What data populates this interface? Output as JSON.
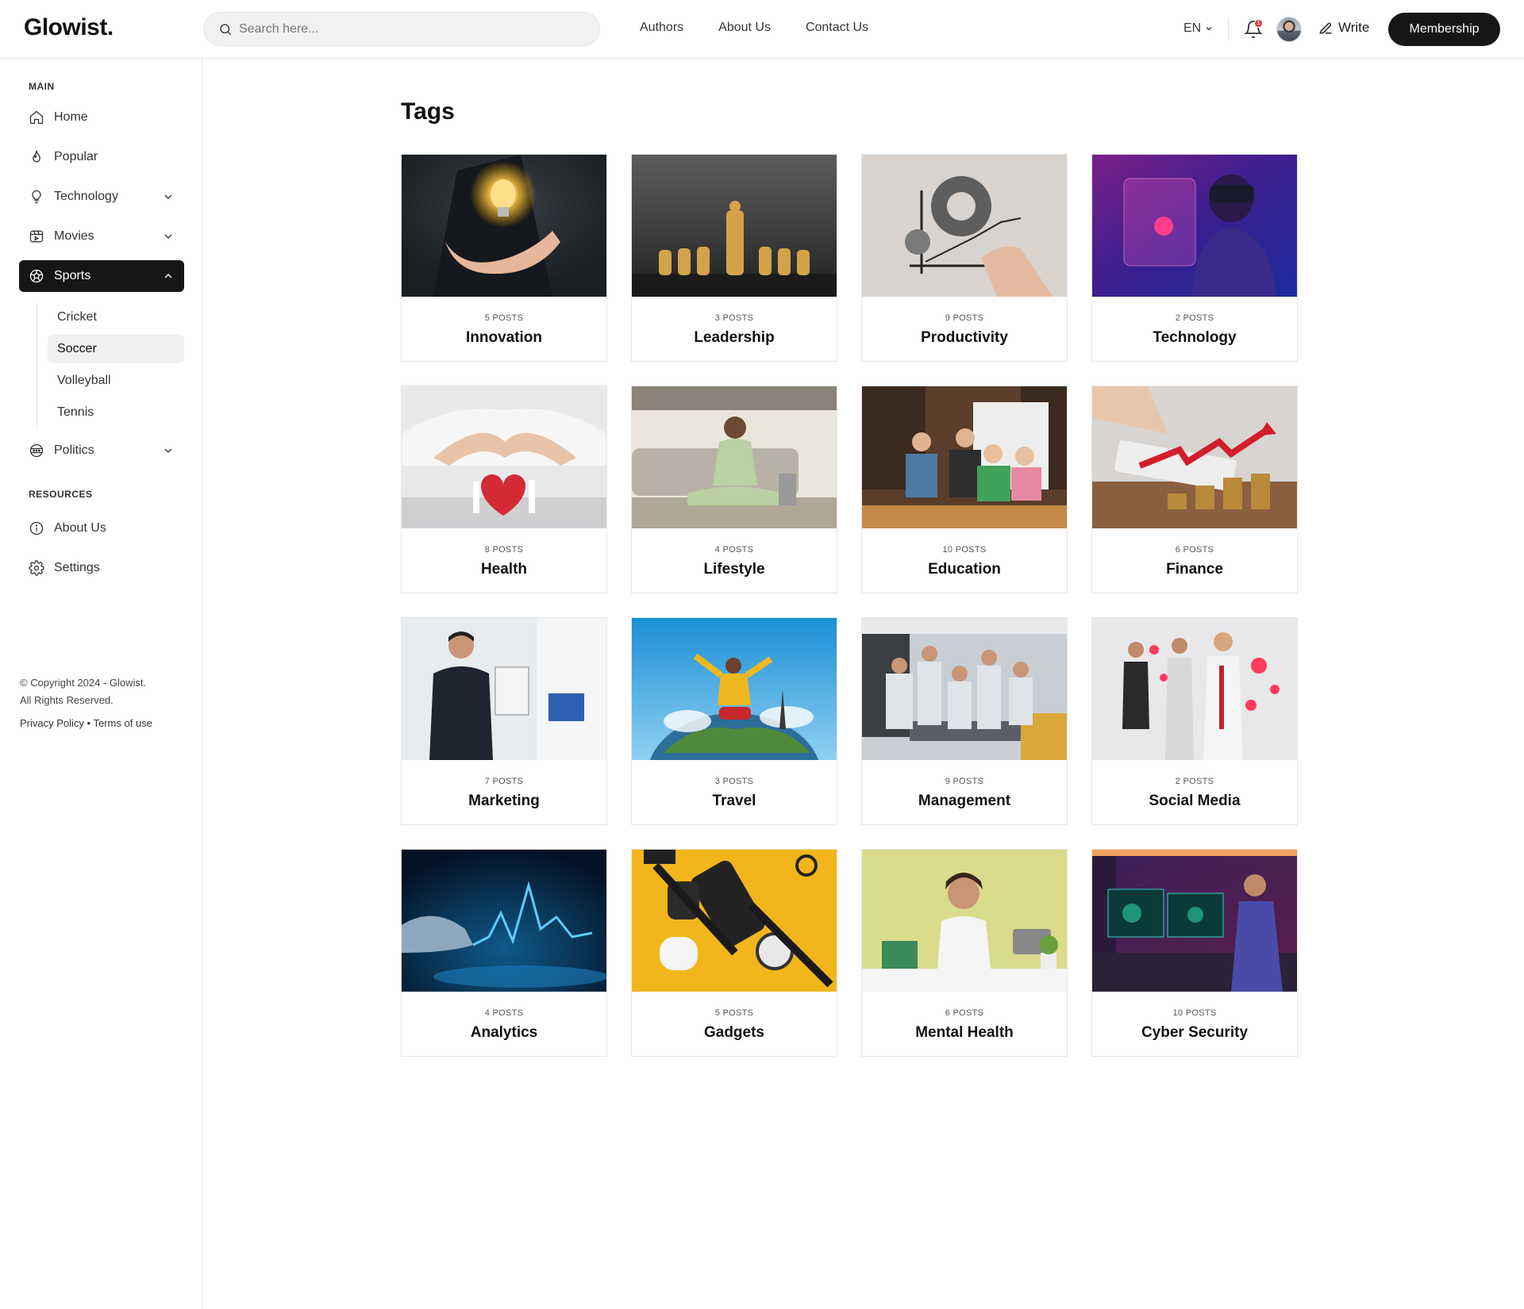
{
  "header": {
    "logo": "Glowist.",
    "search_placeholder": "Search here...",
    "nav": [
      "Authors",
      "About Us",
      "Contact Us"
    ],
    "language": "EN",
    "notification_count": "1",
    "write_label": "Write",
    "membership_label": "Membership"
  },
  "sidebar": {
    "main_title": "MAIN",
    "items": [
      {
        "label": "Home",
        "icon": "home-icon"
      },
      {
        "label": "Popular",
        "icon": "flame-icon"
      },
      {
        "label": "Technology",
        "icon": "bulb-icon"
      },
      {
        "label": "Movies",
        "icon": "film-icon"
      },
      {
        "label": "Sports",
        "icon": "soccer-ball-icon"
      },
      {
        "label": "Politics",
        "icon": "politics-icon"
      }
    ],
    "sports_sub": [
      "Cricket",
      "Soccer",
      "Volleyball",
      "Tennis"
    ],
    "resources_title": "RESOURCES",
    "resources": [
      {
        "label": "About Us",
        "icon": "info-icon"
      },
      {
        "label": "Settings",
        "icon": "gear-icon"
      }
    ],
    "copyright_line1": "© Copyright 2024 - Glowist.",
    "copyright_line2": "All Rights Reserved.",
    "privacy": "Privacy Policy",
    "separator": "•",
    "terms": "Terms of use"
  },
  "main": {
    "title": "Tags",
    "tags": [
      {
        "posts": "5 POSTS",
        "name": "Innovation"
      },
      {
        "posts": "3 POSTS",
        "name": "Leadership"
      },
      {
        "posts": "9 POSTS",
        "name": "Productivity"
      },
      {
        "posts": "2 POSTS",
        "name": "Technology"
      },
      {
        "posts": "8 POSTS",
        "name": "Health"
      },
      {
        "posts": "4 POSTS",
        "name": "Lifestyle"
      },
      {
        "posts": "10 POSTS",
        "name": "Education"
      },
      {
        "posts": "6 POSTS",
        "name": "Finance"
      },
      {
        "posts": "7 POSTS",
        "name": "Marketing"
      },
      {
        "posts": "3 POSTS",
        "name": "Travel"
      },
      {
        "posts": "9 POSTS",
        "name": "Management"
      },
      {
        "posts": "2 POSTS",
        "name": "Social Media"
      },
      {
        "posts": "4 POSTS",
        "name": "Analytics"
      },
      {
        "posts": "5 POSTS",
        "name": "Gadgets"
      },
      {
        "posts": "6 POSTS",
        "name": "Mental Health"
      },
      {
        "posts": "10 POSTS",
        "name": "Cyber Security"
      }
    ]
  },
  "colors": {
    "active_nav_bg": "#161616",
    "notification_badge": "#e53935",
    "border": "#e6e6e6"
  }
}
